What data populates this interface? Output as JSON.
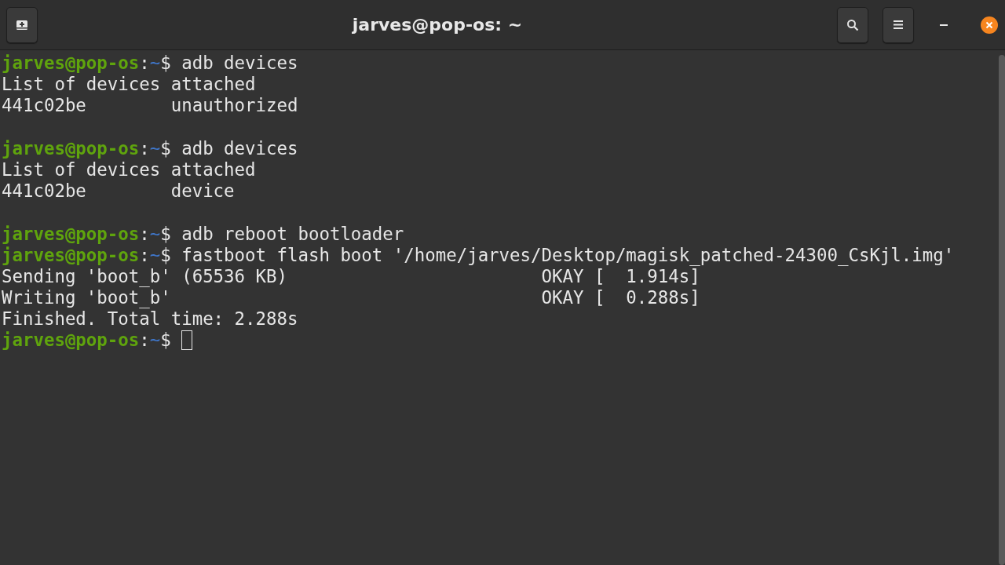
{
  "window": {
    "title": "jarves@pop-os: ~"
  },
  "terminal": {
    "lines": [
      {
        "kind": "prompt",
        "user": "jarves@pop-os",
        "sep": ":",
        "path": "~",
        "symbol": "$",
        "command": "adb devices",
        "cursor": false
      },
      {
        "kind": "output",
        "text": "List of devices attached"
      },
      {
        "kind": "output",
        "text": "441c02be        unauthorized"
      },
      {
        "kind": "blank"
      },
      {
        "kind": "prompt",
        "user": "jarves@pop-os",
        "sep": ":",
        "path": "~",
        "symbol": "$",
        "command": "adb devices",
        "cursor": false
      },
      {
        "kind": "output",
        "text": "List of devices attached"
      },
      {
        "kind": "output",
        "text": "441c02be        device"
      },
      {
        "kind": "blank"
      },
      {
        "kind": "prompt",
        "user": "jarves@pop-os",
        "sep": ":",
        "path": "~",
        "symbol": "$",
        "command": "adb reboot bootloader",
        "cursor": false
      },
      {
        "kind": "prompt",
        "user": "jarves@pop-os",
        "sep": ":",
        "path": "~",
        "symbol": "$",
        "command": "fastboot flash boot '/home/jarves/Desktop/magisk_patched-24300_CsKjl.img'",
        "cursor": false
      },
      {
        "kind": "output",
        "text": "Sending 'boot_b' (65536 KB)                        OKAY [  1.914s]"
      },
      {
        "kind": "output",
        "text": "Writing 'boot_b'                                   OKAY [  0.288s]"
      },
      {
        "kind": "output",
        "text": "Finished. Total time: 2.288s"
      },
      {
        "kind": "prompt",
        "user": "jarves@pop-os",
        "sep": ":",
        "path": "~",
        "symbol": "$",
        "cursor": true
      }
    ]
  }
}
